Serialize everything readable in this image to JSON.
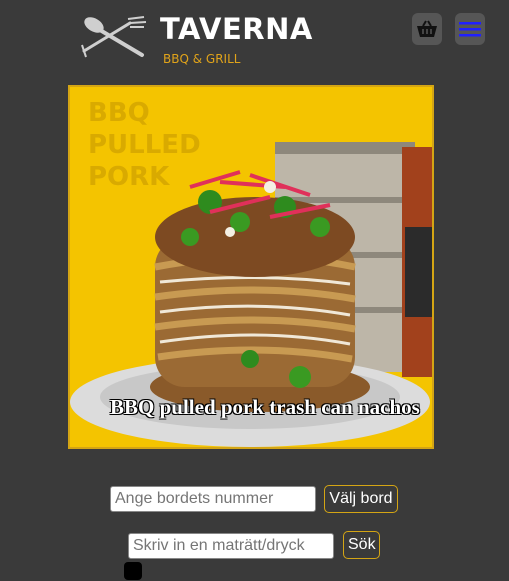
{
  "header": {
    "brand": "TAVERNA",
    "tagline": "BBQ & GRILL",
    "logo_icon": "crossed-cutlery-icon",
    "cart_icon": "basket-icon",
    "menu_icon": "hamburger-icon",
    "menu_icon_color": "#2020ff"
  },
  "hero": {
    "overlay_text": [
      "BBQ",
      "PULLED",
      "PORK"
    ],
    "caption": "BBQ pulled pork trash can nachos",
    "background_color": "#f4c400",
    "border_color": "#d4a514"
  },
  "table_form": {
    "placeholder": "Ange bordets nummer",
    "button": "Välj bord"
  },
  "search_form": {
    "placeholder": "Skriv in en maträtt/dryck",
    "button": "Sök"
  },
  "accent_color": "#d4a514"
}
